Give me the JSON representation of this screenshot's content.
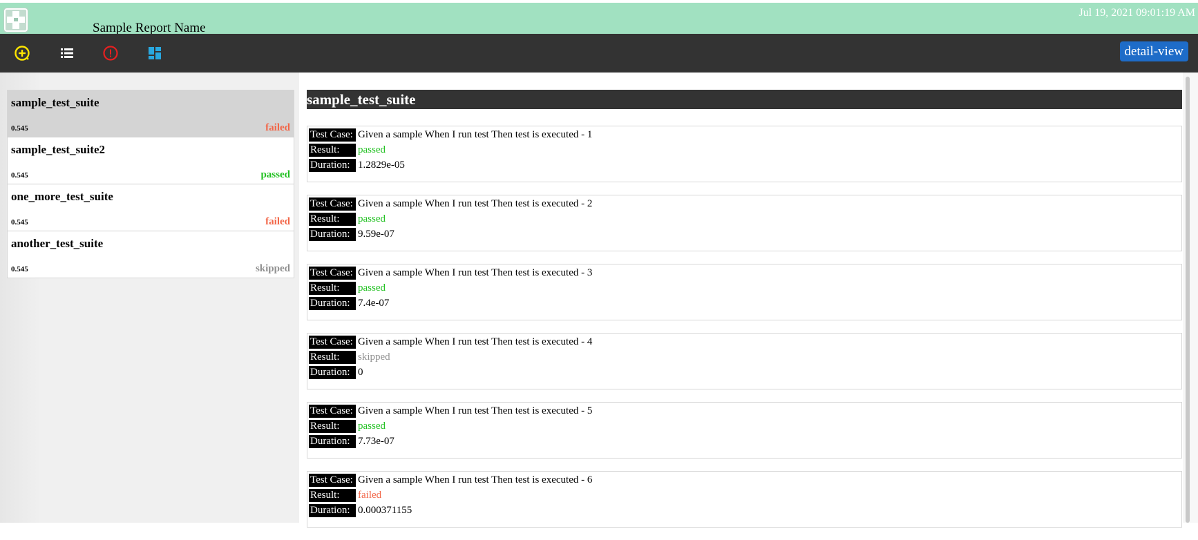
{
  "header": {
    "report_name": "Sample Report Name",
    "timestamp": "Jul 19, 2021 09:01:19 AM",
    "background": "#a1e1c1"
  },
  "toolbar": {
    "icons": [
      {
        "name": "add-circle-icon",
        "color": "#ffe600"
      },
      {
        "name": "list-icon",
        "color": "#ffffff"
      },
      {
        "name": "alert-circle-icon",
        "color": "#e62020"
      },
      {
        "name": "dashboard-icon",
        "color": "#29a8e0"
      }
    ],
    "view_button_label": "detail-view",
    "view_button_color": "#1e6cc8"
  },
  "sidebar": {
    "suites": [
      {
        "name": "sample_test_suite",
        "duration": "0.545",
        "status": "failed",
        "selected": true
      },
      {
        "name": "sample_test_suite2",
        "duration": "0.545",
        "status": "passed",
        "selected": false
      },
      {
        "name": "one_more_test_suite",
        "duration": "0.545",
        "status": "failed",
        "selected": false
      },
      {
        "name": "another_test_suite",
        "duration": "0.545",
        "status": "skipped",
        "selected": false
      }
    ]
  },
  "main": {
    "suite_title": "sample_test_suite",
    "labels": {
      "test_case": "Test Case:",
      "result": "Result:",
      "duration": "Duration:"
    },
    "cases": [
      {
        "name": "Given a sample When I run test Then test is executed - 1",
        "result": "passed",
        "duration": "1.2829e-05"
      },
      {
        "name": "Given a sample When I run test Then test is executed - 2",
        "result": "passed",
        "duration": "9.59e-07"
      },
      {
        "name": "Given a sample When I run test Then test is executed - 3",
        "result": "passed",
        "duration": "7.4e-07"
      },
      {
        "name": "Given a sample When I run test Then test is executed - 4",
        "result": "skipped",
        "duration": "0"
      },
      {
        "name": "Given a sample When I run test Then test is executed - 5",
        "result": "passed",
        "duration": "7.73e-07"
      },
      {
        "name": "Given a sample When I run test Then test is executed - 6",
        "result": "failed",
        "duration": "0.000371155"
      }
    ]
  },
  "status_colors": {
    "passed": "#20c020",
    "failed": "#f26648",
    "skipped": "#909090"
  }
}
